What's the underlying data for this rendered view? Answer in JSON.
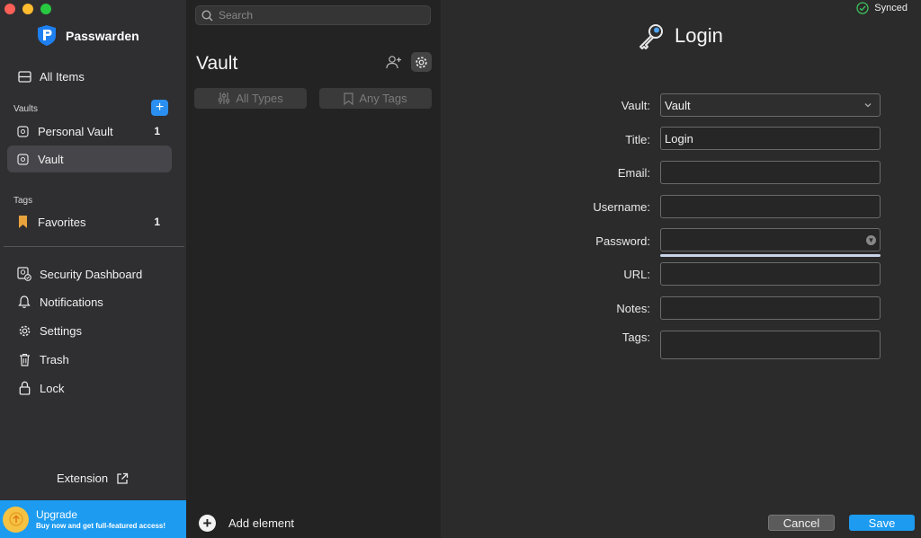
{
  "app": {
    "name": "Passwarden"
  },
  "sidebar": {
    "all_items": "All Items",
    "vaults_label": "Vaults",
    "add_vault_glyph": "+",
    "vaults": [
      {
        "label": "Personal Vault",
        "count": "1"
      },
      {
        "label": "Vault",
        "count": ""
      }
    ],
    "tags_label": "Tags",
    "tags": [
      {
        "label": "Favorites",
        "count": "1"
      }
    ],
    "menu": {
      "security": "Security Dashboard",
      "notifications": "Notifications",
      "settings": "Settings",
      "trash": "Trash",
      "lock": "Lock"
    },
    "extension": "Extension",
    "upgrade": {
      "title": "Upgrade",
      "subtitle": "Buy now and get full-featured access!"
    }
  },
  "list": {
    "search_placeholder": "Search",
    "title": "Vault",
    "filter_types": "All Types",
    "filter_tags": "Any Tags",
    "add_element": "Add element"
  },
  "detail": {
    "status": "Synced",
    "title": "Login",
    "fields": {
      "vault": {
        "label": "Vault:",
        "value": "Vault"
      },
      "title": {
        "label": "Title:",
        "value": "Login"
      },
      "email": {
        "label": "Email:",
        "value": ""
      },
      "username": {
        "label": "Username:",
        "value": ""
      },
      "password": {
        "label": "Password:",
        "value": ""
      },
      "url": {
        "label": "URL:",
        "value": ""
      },
      "notes": {
        "label": "Notes:",
        "value": ""
      },
      "tags": {
        "label": "Tags:",
        "value": ""
      }
    },
    "cancel": "Cancel",
    "save": "Save"
  },
  "colors": {
    "accent": "#1c9bf0",
    "upgrade_badge": "#f6c243",
    "synced_green": "#3fbf5a"
  }
}
